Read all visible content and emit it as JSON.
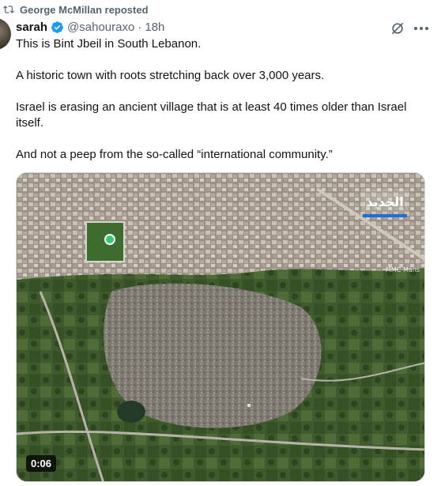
{
  "repost": {
    "text": "George McMillan reposted",
    "icon": "repost-icon"
  },
  "author": {
    "name": "sarah",
    "handle": "@sahouraxo",
    "separator": "·",
    "time": "18h",
    "verified_color": "#1d9bf0"
  },
  "tweet": {
    "paragraphs": [
      "This is Bint Jbeil in South Lebanon.",
      "A historic town with roots stretching back over 3,000 years.",
      "Israel is erasing an ancient village that is at least 40 times older than Israel itself.",
      "And not a peep from the so-called “international community.”"
    ]
  },
  "media": {
    "timestamp": "0:06",
    "watermark": "MMC Mans",
    "logo_text": "الجديد"
  },
  "colors": {
    "text": "#0f1419",
    "secondary": "#536471",
    "accent": "#1d9bf0"
  }
}
